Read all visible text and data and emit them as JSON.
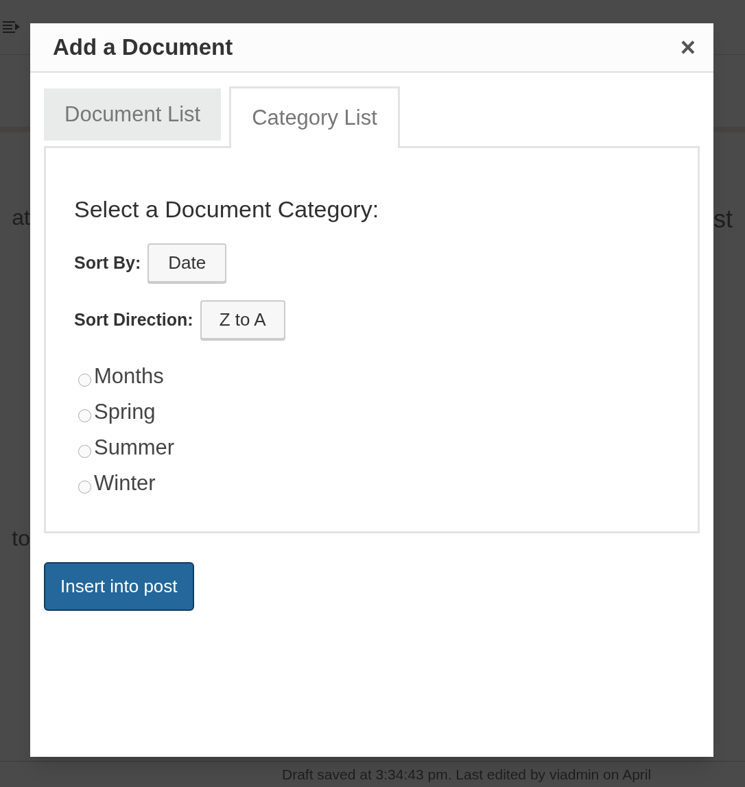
{
  "background": {
    "left_fragments": [
      "at",
      "to"
    ],
    "right_fragments": [
      "st"
    ],
    "status_bar": "Draft saved at 3:34:43 pm. Last edited by viadmin on April"
  },
  "dialog": {
    "title": "Add a Document",
    "close": "×",
    "tabs": [
      {
        "label": "Document List",
        "selected": false
      },
      {
        "label": "Category List",
        "selected": true
      }
    ],
    "heading": "Select a Document Category:",
    "sort_by": {
      "label": "Sort By:",
      "value": "Date"
    },
    "sort_direction": {
      "label": "Sort Direction:",
      "value": "Z to A"
    },
    "categories": [
      {
        "label": "Months",
        "selected": false
      },
      {
        "label": "Spring",
        "selected": false
      },
      {
        "label": "Summer",
        "selected": false
      },
      {
        "label": "Winter",
        "selected": false
      }
    ],
    "insert_button": "Insert into post"
  }
}
